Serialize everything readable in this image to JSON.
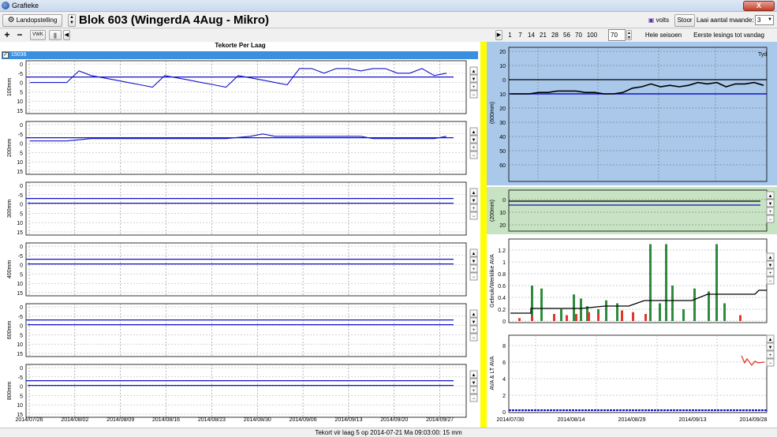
{
  "window": {
    "title": "Grafieke",
    "close_label": "X"
  },
  "toolbar": {
    "settings_label": "Landopstelling",
    "block_title": "Blok 603 (WingerdA 4Aug - Mikro)",
    "volts_label": "volts",
    "store_label": "Stoor",
    "load_months_label": "Laai aantal maande:",
    "load_months_value": "3",
    "zoom_in": "+",
    "zoom_out": "−",
    "vwk_label": "VWK",
    "day_buttons": [
      "1",
      "7",
      "14",
      "21",
      "28",
      "56",
      "70",
      "100"
    ],
    "days_value": "70",
    "whole_season_label": "Hele seisoen",
    "first_readings_label": "Eerste lesings tot vandag"
  },
  "left_panel": {
    "title": "Tekorte Per Laag",
    "series_id": "15036",
    "x_dates": [
      "2014/07/26",
      "2014/08/02",
      "2014/08/09",
      "2014/08/16",
      "2014/08/23",
      "2014/08/30",
      "2014/09/06",
      "2014/09/13",
      "2014/09/20",
      "2014/09/27"
    ],
    "y_ticks": [
      "0",
      "-5",
      "0",
      "5",
      "10",
      "15"
    ],
    "layers": [
      "100mm",
      "200mm",
      "300mm",
      "400mm",
      "600mm",
      "800mm"
    ]
  },
  "right_panel": {
    "chart1": {
      "ylabel": "(600mm)",
      "ticks": [
        "20",
        "10",
        "0",
        "10",
        "20",
        "30",
        "40",
        "50",
        "60"
      ],
      "legend": "Tyd"
    },
    "chart2": {
      "ylabel": "(200mm)",
      "ticks": [
        "0",
        "10",
        "20"
      ]
    },
    "chart3": {
      "ylabel": "Gebruik/Werklike AVA",
      "ticks": [
        "1.2",
        "1",
        "0.8",
        "0.6",
        "0.4",
        "0.2",
        "0"
      ]
    },
    "chart4": {
      "ylabel": "AVA & LT AVA",
      "ticks": [
        "8",
        "6",
        "4",
        "2",
        "0"
      ]
    },
    "x_dates": [
      "2014/07/30",
      "2014/08/14",
      "2014/08/29",
      "2014/09/13",
      "2014/09/28"
    ]
  },
  "status": {
    "text": "Tekort vir laag 5 op 2014-07-21 Ma 09:03:00: 15 mm"
  },
  "chart_data": [
    {
      "type": "line",
      "panel": "100mm",
      "series": [
        {
          "values": [
            3,
            3,
            3,
            3,
            -2,
            0,
            1,
            2,
            3,
            4,
            5,
            0,
            1,
            2,
            3,
            4,
            5,
            0,
            1,
            2,
            3,
            4,
            -3,
            -3,
            -1,
            -3,
            -3,
            -2,
            -3,
            -3,
            -1,
            -1,
            -3,
            0,
            -1
          ]
        }
      ],
      "ylim": [
        -5,
        15
      ]
    },
    {
      "type": "line",
      "panel": "200mm",
      "series": [
        {
          "values": [
            2,
            2,
            2,
            2,
            1.5,
            1,
            1,
            1,
            1,
            1,
            1,
            1,
            1,
            1,
            1,
            1,
            1,
            0.5,
            0,
            -1,
            0,
            0,
            0,
            0,
            0,
            0,
            0,
            0,
            1,
            1,
            1,
            1,
            1,
            1,
            0
          ]
        }
      ],
      "ylim": [
        -5,
        15
      ]
    },
    {
      "type": "line",
      "panel": "600mm (right top)",
      "series": [
        {
          "values": [
            10,
            10,
            10,
            9,
            9,
            8,
            8,
            8,
            9,
            9,
            10,
            10,
            9,
            6,
            5,
            3,
            5,
            4,
            5,
            4,
            2,
            3,
            2,
            5,
            3,
            3,
            2,
            4
          ]
        }
      ],
      "ylim": [
        -20,
        60
      ]
    }
  ]
}
